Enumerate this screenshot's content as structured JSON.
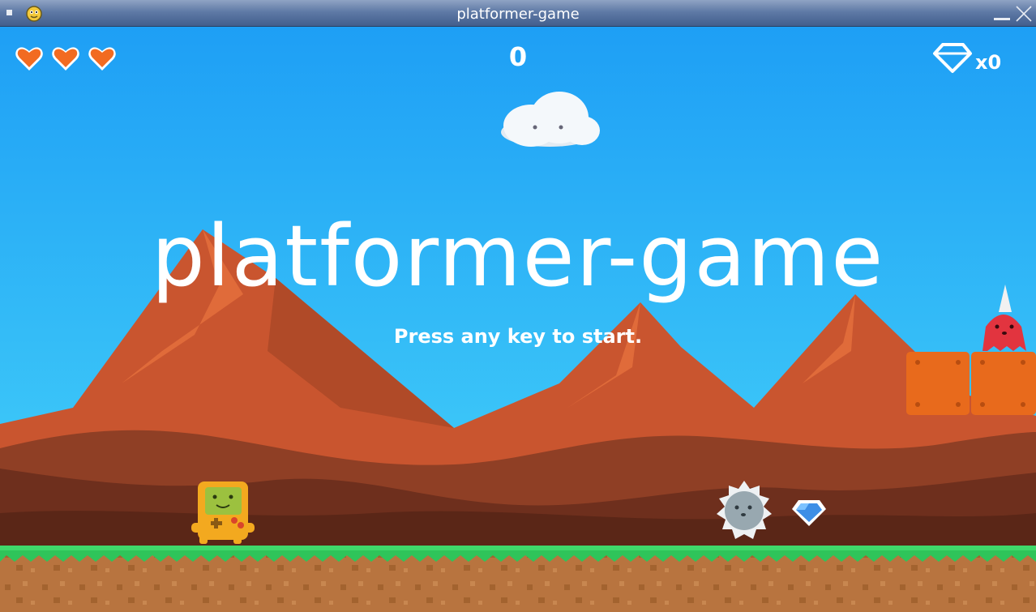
{
  "window": {
    "title": "platformer-game"
  },
  "hud": {
    "hearts": [
      {
        "icon": "heart-icon",
        "color": "#f26b21"
      },
      {
        "icon": "heart-icon",
        "color": "#f26b21"
      },
      {
        "icon": "heart-icon",
        "color": "#f26b21"
      }
    ],
    "score": "0",
    "gem_count": "x0",
    "gem_icon": "diamond-icon"
  },
  "screen": {
    "title": "platformer-game",
    "subtitle": "Press any key to start."
  },
  "colors": {
    "sky_top": "#1e9ff5",
    "sky_bottom": "#48d6f9",
    "mountain": "#c9552f",
    "grass": "#2fc45a",
    "dirt": "#b8743f",
    "platform": "#e86a1c",
    "heart": "#f26b21"
  }
}
